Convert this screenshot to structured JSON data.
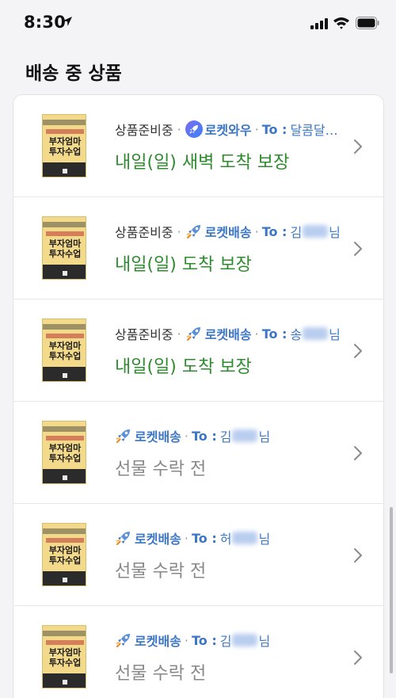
{
  "status_bar": {
    "time": "8:30"
  },
  "section_title": "배송 중 상품",
  "items": [
    {
      "state": "상품준비중",
      "service": "로켓와우",
      "service_type": "wow",
      "to_label": "To :",
      "recipient_prefix": "달콤달…",
      "recipient_suffix": "",
      "has_blur": false,
      "main_text": "내일(일) 새벽 도착 보장",
      "main_style": "delivery",
      "book_title_1": "부자엄마",
      "book_title_2": "투자수업"
    },
    {
      "state": "상품준비중",
      "service": "로켓배송",
      "service_type": "rocket",
      "to_label": "To :",
      "recipient_prefix": "김",
      "recipient_suffix": "님",
      "has_blur": true,
      "main_text": "내일(일) 도착 보장",
      "main_style": "delivery",
      "book_title_1": "부자엄마",
      "book_title_2": "투자수업"
    },
    {
      "state": "상품준비중",
      "service": "로켓배송",
      "service_type": "rocket",
      "to_label": "To :",
      "recipient_prefix": "송",
      "recipient_suffix": "님",
      "has_blur": true,
      "main_text": "내일(일) 도착 보장",
      "main_style": "delivery",
      "book_title_1": "부자엄마",
      "book_title_2": "투자수업"
    },
    {
      "state": "",
      "service": "로켓배송",
      "service_type": "rocket",
      "to_label": "To :",
      "recipient_prefix": "김",
      "recipient_suffix": "님",
      "has_blur": true,
      "main_text": "선물 수락 전",
      "main_style": "gift",
      "book_title_1": "부자엄마",
      "book_title_2": "투자수업"
    },
    {
      "state": "",
      "service": "로켓배송",
      "service_type": "rocket",
      "to_label": "To :",
      "recipient_prefix": "허",
      "recipient_suffix": "님",
      "has_blur": true,
      "main_text": "선물 수락 전",
      "main_style": "gift",
      "book_title_1": "부자엄마",
      "book_title_2": "투자수업"
    },
    {
      "state": "",
      "service": "로켓배송",
      "service_type": "rocket",
      "to_label": "To :",
      "recipient_prefix": "김",
      "recipient_suffix": "님",
      "has_blur": true,
      "main_text": "선물 수락 전",
      "main_style": "gift",
      "book_title_1": "부자엄마",
      "book_title_2": "투자수업"
    }
  ],
  "colors": {
    "delivery_green": "#2e8b2e",
    "rocket_blue": "#3c76c6",
    "gift_gray": "#888888"
  }
}
